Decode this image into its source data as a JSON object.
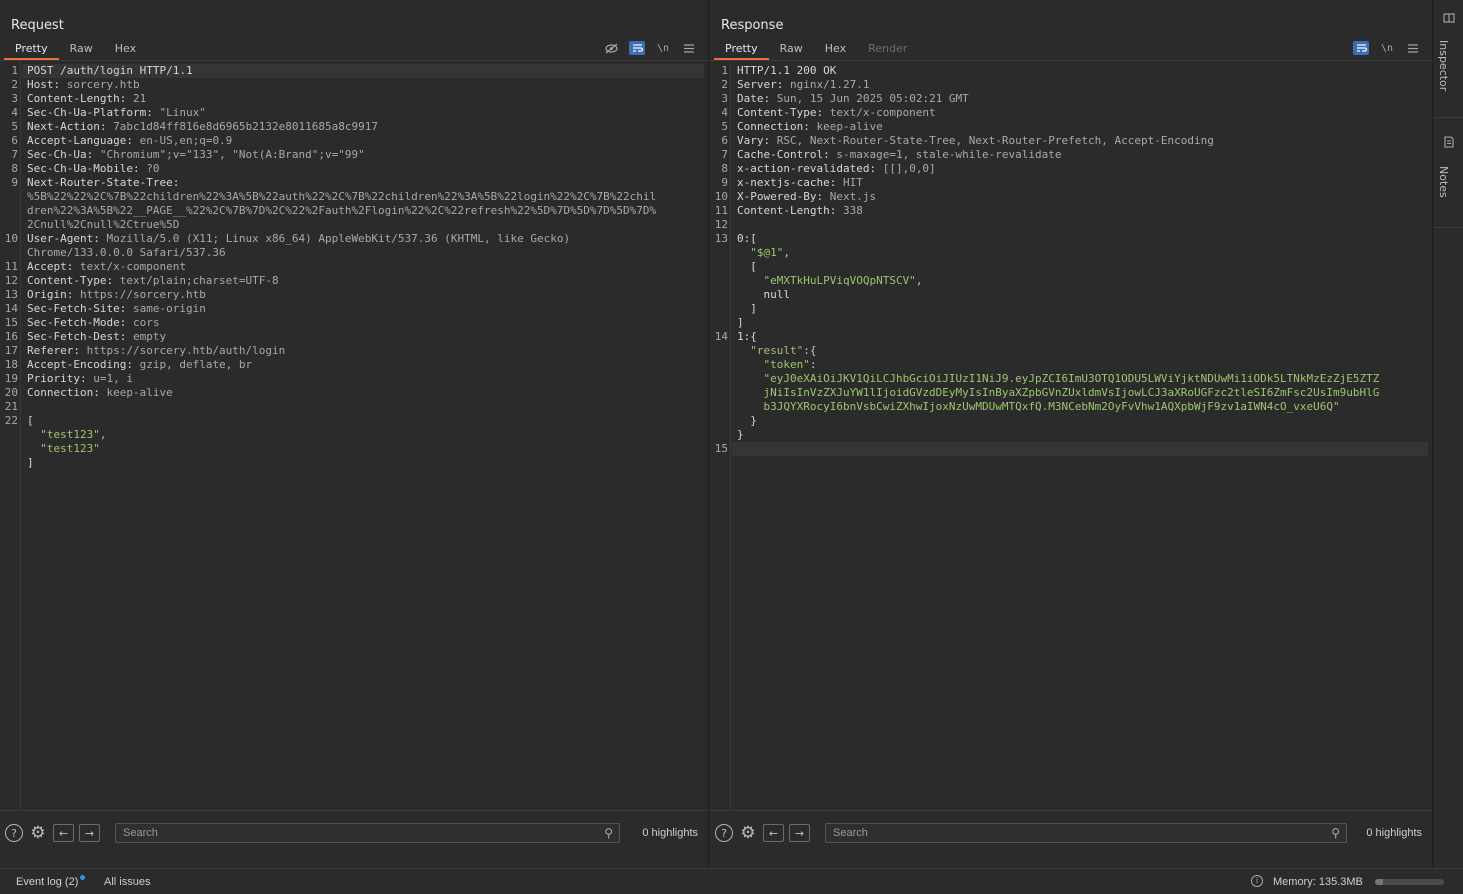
{
  "request": {
    "title": "Request",
    "tabs": [
      "Pretty",
      "Raw",
      "Hex"
    ],
    "active_tab": "Pretty",
    "tool_icons": [
      "eye-off-icon",
      "wrap-icon",
      "\\n",
      "menu-icon"
    ],
    "lines": [
      {
        "n": "1",
        "k": "POST /auth/login HTTP/1.1",
        "v": ""
      },
      {
        "n": "2",
        "k": "Host:",
        "v": " sorcery.htb"
      },
      {
        "n": "3",
        "k": "Content-Length:",
        "v": " 21"
      },
      {
        "n": "4",
        "k": "Sec-Ch-Ua-Platform:",
        "v": " \"Linux\""
      },
      {
        "n": "5",
        "k": "Next-Action:",
        "v": " 7abc1d84ff816e8d6965b2132e8011685a8c9917"
      },
      {
        "n": "6",
        "k": "Accept-Language:",
        "v": " en-US,en;q=0.9"
      },
      {
        "n": "7",
        "k": "Sec-Ch-Ua:",
        "v": " \"Chromium\";v=\"133\", \"Not(A:Brand\";v=\"99\""
      },
      {
        "n": "8",
        "k": "Sec-Ch-Ua-Mobile:",
        "v": " ?0"
      },
      {
        "n": "9",
        "k": "Next-Router-State-Tree:",
        "v": ""
      },
      {
        "n": "",
        "k": "",
        "v": "%5B%22%22%2C%7B%22children%22%3A%5B%22auth%22%2C%7B%22children%22%3A%5B%22login%22%2C%7B%22chil"
      },
      {
        "n": "",
        "k": "",
        "v": "dren%22%3A%5B%22__PAGE__%22%2C%7B%7D%2C%22%2Fauth%2Flogin%22%2C%22refresh%22%5D%7D%5D%7D%5D%7D%"
      },
      {
        "n": "",
        "k": "",
        "v": "2Cnull%2Cnull%2Ctrue%5D"
      },
      {
        "n": "10",
        "k": "User-Agent:",
        "v": " Mozilla/5.0 (X11; Linux x86_64) AppleWebKit/537.36 (KHTML, like Gecko)"
      },
      {
        "n": "",
        "k": "",
        "v": "Chrome/133.0.0.0 Safari/537.36"
      },
      {
        "n": "11",
        "k": "Accept:",
        "v": " text/x-component"
      },
      {
        "n": "12",
        "k": "Content-Type:",
        "v": " text/plain;charset=UTF-8"
      },
      {
        "n": "13",
        "k": "Origin:",
        "v": " https://sorcery.htb"
      },
      {
        "n": "14",
        "k": "Sec-Fetch-Site:",
        "v": " same-origin"
      },
      {
        "n": "15",
        "k": "Sec-Fetch-Mode:",
        "v": " cors"
      },
      {
        "n": "16",
        "k": "Sec-Fetch-Dest:",
        "v": " empty"
      },
      {
        "n": "17",
        "k": "Referer:",
        "v": " https://sorcery.htb/auth/login"
      },
      {
        "n": "18",
        "k": "Accept-Encoding:",
        "v": " gzip, deflate, br"
      },
      {
        "n": "19",
        "k": "Priority:",
        "v": " u=1, i"
      },
      {
        "n": "20",
        "k": "Connection:",
        "v": " keep-alive"
      },
      {
        "n": "21",
        "k": "",
        "v": ""
      },
      {
        "n": "22",
        "k": "[",
        "v": ""
      },
      {
        "n": "",
        "k": "",
        "v": "",
        "s": "  \"test123\","
      },
      {
        "n": "",
        "k": "",
        "v": "",
        "s": "  \"test123\""
      },
      {
        "n": "",
        "k": "]",
        "v": ""
      }
    ],
    "search_placeholder": "Search",
    "highlights": "0 highlights"
  },
  "response": {
    "title": "Response",
    "tabs": [
      "Pretty",
      "Raw",
      "Hex",
      "Render"
    ],
    "active_tab": "Pretty",
    "tool_icons": [
      "wrap-icon",
      "\\n",
      "menu-icon"
    ],
    "lines": [
      {
        "n": "1",
        "k": "HTTP/1.1 200 OK",
        "v": ""
      },
      {
        "n": "2",
        "k": "Server:",
        "v": " nginx/1.27.1"
      },
      {
        "n": "3",
        "k": "Date:",
        "v": " Sun, 15 Jun 2025 05:02:21 GMT"
      },
      {
        "n": "4",
        "k": "Content-Type:",
        "v": " text/x-component"
      },
      {
        "n": "5",
        "k": "Connection:",
        "v": " keep-alive"
      },
      {
        "n": "6",
        "k": "Vary:",
        "v": " RSC, Next-Router-State-Tree, Next-Router-Prefetch, Accept-Encoding"
      },
      {
        "n": "7",
        "k": "Cache-Control:",
        "v": " s-maxage=1, stale-while-revalidate"
      },
      {
        "n": "8",
        "k": "x-action-revalidated:",
        "v": " [[],0,0]"
      },
      {
        "n": "9",
        "k": "x-nextjs-cache:",
        "v": " HIT"
      },
      {
        "n": "10",
        "k": "X-Powered-By:",
        "v": " Next.js"
      },
      {
        "n": "11",
        "k": "Content-Length:",
        "v": " 338"
      },
      {
        "n": "12",
        "k": "",
        "v": ""
      },
      {
        "n": "13",
        "k": "0:[",
        "v": ""
      },
      {
        "n": "",
        "k": "",
        "v": "",
        "s": "  \"$@1\"",
        "p": ","
      },
      {
        "n": "",
        "k": "  [",
        "v": ""
      },
      {
        "n": "",
        "k": "",
        "v": "",
        "s": "    \"eMXTkHuLPViqVOQpNTSCV\"",
        "p": ","
      },
      {
        "n": "",
        "k": "    null",
        "v": ""
      },
      {
        "n": "",
        "k": "  ]",
        "v": ""
      },
      {
        "n": "",
        "k": "]",
        "v": ""
      },
      {
        "n": "14",
        "k": "1:{",
        "v": ""
      },
      {
        "n": "",
        "k": "",
        "v": "",
        "s": "  \"result\"",
        "p": ":{"
      },
      {
        "n": "",
        "k": "",
        "v": "",
        "s": "    \"token\"",
        "p": ":"
      },
      {
        "n": "",
        "k": "",
        "v": "",
        "s": "    \"eyJ0eXAiOiJKV1QiLCJhbGciOiJIUzI1NiJ9.eyJpZCI6ImU3OTQ1ODU5LWViYjktNDUwMi1iODk5LTNkMzEzZjE5ZTZ"
      },
      {
        "n": "",
        "k": "",
        "v": "",
        "s": "    jNiIsInVzZXJuYW1lIjoidGVzdDEyMyIsInByaXZpbGVnZUxldmVsIjowLCJ3aXRoUGFzc2tleSI6ZmFsc2UsIm9ubHlG"
      },
      {
        "n": "",
        "k": "",
        "v": "",
        "s": "    b3JQYXRocyI6bnVsbCwiZXhwIjoxNzUwMDUwMTQxfQ.M3NCebNm2OyFvVhw1AQXpbWjF9zv1aIWN4cO_vxeU6Q\""
      },
      {
        "n": "",
        "k": "  }",
        "v": ""
      },
      {
        "n": "",
        "k": "}",
        "v": ""
      },
      {
        "n": "15",
        "k": "",
        "v": "",
        "cur": true
      }
    ],
    "search_placeholder": "Search",
    "highlights": "0 highlights"
  },
  "side_panel": {
    "inspector": "Inspector",
    "notes": "Notes"
  },
  "status": {
    "event_log": "Event log (2)",
    "all_issues": "All issues",
    "memory": "Memory: 135.3MB",
    "memory_fraction": 0.12
  },
  "colors": {
    "accent": "#e8703a",
    "toggle_on": "#3a6fb5",
    "string": "#9fc56e"
  }
}
